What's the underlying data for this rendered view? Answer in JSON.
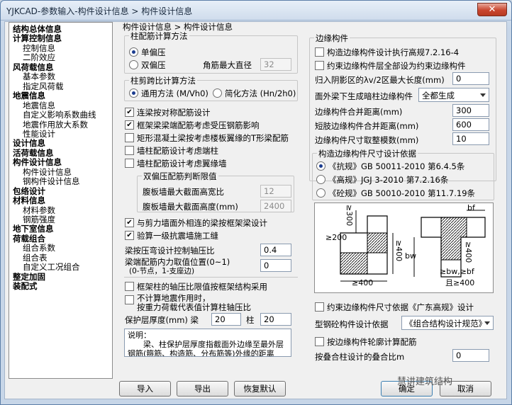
{
  "window": {
    "title": "YJKCAD-参数输入-构件设计信息 > 构件设计信息",
    "close_symbol": "✕"
  },
  "tree": {
    "items": [
      {
        "label": "结构总体信息",
        "bold": true,
        "indent": 0
      },
      {
        "label": "计算控制信息",
        "bold": true,
        "indent": 0
      },
      {
        "label": "控制信息",
        "bold": false,
        "indent": 1
      },
      {
        "label": "二阶效应",
        "bold": false,
        "indent": 1
      },
      {
        "label": "风荷载信息",
        "bold": true,
        "indent": 0
      },
      {
        "label": "基本参数",
        "bold": false,
        "indent": 1
      },
      {
        "label": "指定风荷载",
        "bold": false,
        "indent": 1
      },
      {
        "label": "地震信息",
        "bold": true,
        "indent": 0
      },
      {
        "label": "地震信息",
        "bold": false,
        "indent": 1
      },
      {
        "label": "自定义影响系数曲线",
        "bold": false,
        "indent": 1
      },
      {
        "label": "地震作用放大系数",
        "bold": false,
        "indent": 1
      },
      {
        "label": "性能设计",
        "bold": false,
        "indent": 1
      },
      {
        "label": "设计信息",
        "bold": true,
        "indent": 0
      },
      {
        "label": "活荷载信息",
        "bold": true,
        "indent": 0
      },
      {
        "label": "构件设计信息",
        "bold": true,
        "indent": 0
      },
      {
        "label": "构件设计信息",
        "bold": false,
        "indent": 1
      },
      {
        "label": "钢构件设计信息",
        "bold": false,
        "indent": 1
      },
      {
        "label": "包络设计",
        "bold": true,
        "indent": 0
      },
      {
        "label": "材料信息",
        "bold": true,
        "indent": 0
      },
      {
        "label": "材料参数",
        "bold": false,
        "indent": 1
      },
      {
        "label": "钢筋强度",
        "bold": false,
        "indent": 1
      },
      {
        "label": "地下室信息",
        "bold": true,
        "indent": 0
      },
      {
        "label": "荷载组合",
        "bold": true,
        "indent": 0
      },
      {
        "label": "组合系数",
        "bold": false,
        "indent": 1
      },
      {
        "label": "组合表",
        "bold": false,
        "indent": 1
      },
      {
        "label": "自定义工况组合",
        "bold": false,
        "indent": 1
      },
      {
        "label": "整定加固",
        "bold": true,
        "indent": 0
      },
      {
        "label": "装配式",
        "bold": true,
        "indent": 0
      }
    ]
  },
  "breadcrumb": "构件设计信息 > 构件设计信息",
  "column_calc": {
    "title": "柱配筋计算方法",
    "single": "单偏压",
    "double": "双偏压",
    "selected": "single",
    "corner_label": "角筋最大直径",
    "corner_value": "32"
  },
  "shear_span": {
    "title": "柱剪跨比计算方法",
    "general": "通用方法 (M/Vh0)",
    "simplified": "简化方法 (Hn/2h0)",
    "selected": "general"
  },
  "options": {
    "cb1": {
      "label": "连梁按对称配筋设计",
      "checked": true
    },
    "cb2": {
      "label": "框架梁梁端配筋考虑受压钢筋影响",
      "checked": true
    },
    "cb3": {
      "label": "矩形混凝土梁按考虑楼板翼缘的T形梁配筋",
      "checked": false
    },
    "cb4": {
      "label": "墙柱配筋设计考虑端柱",
      "checked": false
    },
    "cb5": {
      "label": "墙柱配筋设计考虑翼缘墙",
      "checked": false
    }
  },
  "double_bias": {
    "title": "双偏压配筋判断限值",
    "height_ratio_label": "腹板墙最大截面高宽比",
    "height_ratio_value": "12",
    "max_height_label": "腹板墙最大截面高度(mm)",
    "max_height_value": "2400"
  },
  "options2": {
    "cb6": {
      "label": "与剪力墙面外相连的梁按框架梁设计",
      "checked": true
    },
    "cb7": {
      "label": "验算一级抗震墙施工缝",
      "checked": true
    }
  },
  "beam_axial": {
    "label": "梁按压弯设计控制轴压比",
    "value": "0.4"
  },
  "beam_torsion": {
    "label_line1": "梁端配筋内力取值位置(0~1)",
    "label_line2": "(0-节点，1-支座边)",
    "value": "0"
  },
  "frame_col": {
    "label": "框架柱的轴压比限值按框架结构采用",
    "checked": false
  },
  "no_seismic": {
    "label_line1": "不计算地震作用时，",
    "label_line2": "按重力荷载代表值计算柱轴压比",
    "checked": false
  },
  "cover": {
    "label": "保护层厚度(mm) 梁",
    "beam_value": "20",
    "col_label": "柱",
    "col_value": "20"
  },
  "note": {
    "title": "说明：",
    "text": "梁、柱保护层厚度指截面外边缘至最外层钢筋(箍筋、构造筋、分布筋等)外缘的距离"
  },
  "edge": {
    "title": "边缘构件",
    "cb_a": {
      "label": "构造边缘构件设计执行高规7.2.16-4",
      "checked": false
    },
    "cb_b": {
      "label": "约束边缘构件层全部设为约束边缘构件",
      "checked": false
    },
    "lambda_label": "归入阴影区的λv/2区最大长度(mm)",
    "lambda_value": "0",
    "generate_label": "面外梁下生成暗柱边缘构件",
    "generate_value": "全都生成",
    "merge_label": "边缘构件合并距离(mm)",
    "merge_value": "300",
    "short_label": "短肢边缘构件合并距离(mm)",
    "short_value": "600",
    "modulus_label": "边缘构件尺寸取整模数(mm)",
    "modulus_value": "10"
  },
  "basis": {
    "title": "构造边缘构件尺寸设计依据",
    "opt1": "《抗规》GB 50011-2010 第6.4.5条",
    "opt2": "《高规》JGJ 3-2010 第7.2.16条",
    "opt3": "《砼规》GB 50010-2010 第11.7.19条",
    "selected": "opt1"
  },
  "diagram": {
    "labels": {
      "ge200": "≥200",
      "ge300": "≥300",
      "ge400a": "≥400",
      "ge400b": "≥400",
      "ge400c": "≥400",
      "bf": "bf",
      "bw": "bw",
      "gebw": "≥bw,≥bf",
      "ge400d": "且≥400"
    }
  },
  "guangdong": {
    "label": "约束边缘构件尺寸依据《广东高规》设计",
    "checked": false
  },
  "steel_basis": {
    "label": "型钢砼构件设计依据",
    "value": "《组合结构设计规范》"
  },
  "outline": {
    "label": "按边缘构件轮廓计算配筋",
    "checked": false
  },
  "stack": {
    "label": "按叠合柱设计的叠合比m",
    "value": "0"
  },
  "buttons": {
    "import": "导入",
    "export": "导出",
    "reset": "恢复默认",
    "ok": "确定",
    "cancel": "取消"
  },
  "watermark": "慧讲建筑结构"
}
